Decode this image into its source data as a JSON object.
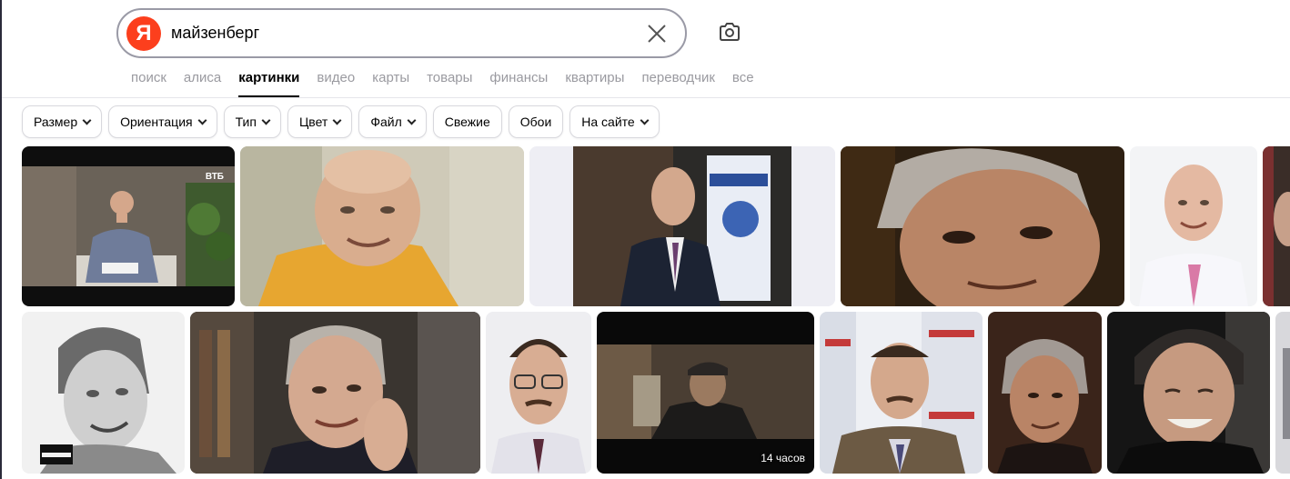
{
  "search": {
    "logo_letter": "Я",
    "query": "майзенберг"
  },
  "tabs": [
    "поиск",
    "алиса",
    "картинки",
    "видео",
    "карты",
    "товары",
    "финансы",
    "квартиры",
    "переводчик",
    "все"
  ],
  "active_tab": "картинки",
  "filters": [
    {
      "label": "Размер",
      "dropdown": true
    },
    {
      "label": "Ориентация",
      "dropdown": true
    },
    {
      "label": "Тип",
      "dropdown": true
    },
    {
      "label": "Цвет",
      "dropdown": true
    },
    {
      "label": "Файл",
      "dropdown": true
    },
    {
      "label": "Свежие",
      "dropdown": false
    },
    {
      "label": "Обои",
      "dropdown": false
    },
    {
      "label": "На сайте",
      "dropdown": true
    }
  ],
  "tile_texts": {
    "vtb_watermark": "ВТБ",
    "video_duration": "14 часов",
    "album_label": "PARENTAL ADVISORY"
  },
  "colors": {
    "logo_red": "#fc3f1d",
    "accent": "#000000"
  },
  "icons": {
    "clear": "close-icon",
    "camera": "camera-icon",
    "chevron": "chevron-down-icon"
  }
}
